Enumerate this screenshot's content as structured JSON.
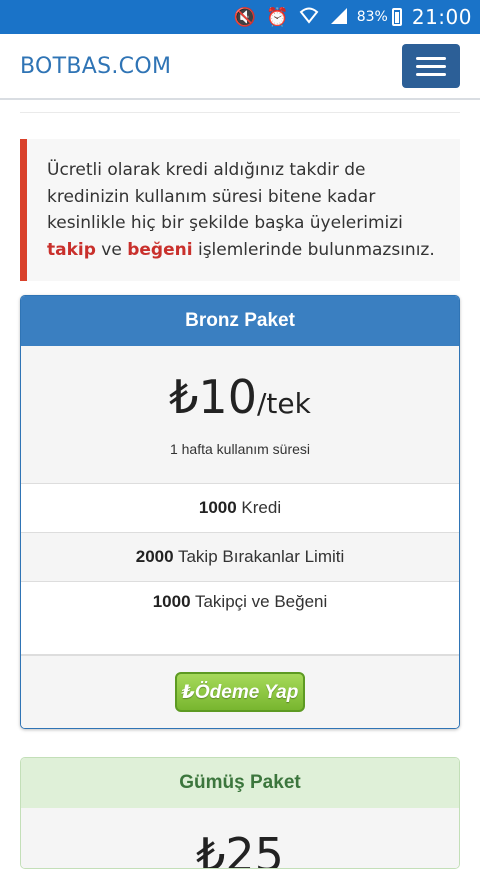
{
  "status_bar": {
    "icons": [
      "mute-icon",
      "alarm-icon",
      "wifi-icon",
      "signal-icon"
    ],
    "battery_pct": "83%",
    "time": "21:00"
  },
  "navbar": {
    "brand": "BOTBAS.COM",
    "menu_icon": "hamburger-icon"
  },
  "alert": {
    "text_1": "Ücretli olarak kredi aldığınız takdir de kredinizin kullanım süresi bitene kadar kesinlikle hiç bir şekilde başka üyelerimizi ",
    "highlight_1": "takip",
    "text_2": " ve ",
    "highlight_2": "beğeni",
    "text_3": " işlemlerinde bulunmazsınız.",
    "border_color": "#d9412b"
  },
  "packages": [
    {
      "title": "Bronz Paket",
      "price": "₺10",
      "per": "/tek",
      "duration": "1 hafta kullanım süresi",
      "features": [
        {
          "amount": "1000",
          "label": " Kredi"
        },
        {
          "amount": "2000",
          "label": " Takip Bırakanlar Limiti"
        },
        {
          "amount": "1000",
          "label": " Takipçi ve Beğeni"
        }
      ],
      "button_label": "₺Ödeme Yap",
      "accent": "#3a7fc1"
    },
    {
      "title": "Gümüş Paket",
      "price": "₺25",
      "accent": "#dff0d8"
    }
  ]
}
